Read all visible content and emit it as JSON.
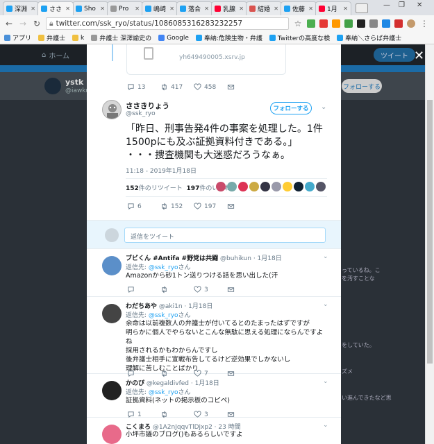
{
  "browser": {
    "tabs": [
      {
        "label": "深淵",
        "icon_color": "#1da1f2",
        "icon": "twitter-icon"
      },
      {
        "label": "ささ",
        "icon_color": "#1da1f2",
        "icon": "twitter-icon",
        "active": true
      },
      {
        "label": "Sho",
        "icon_color": "#1da1f2",
        "icon": "twitter-icon"
      },
      {
        "label": "Pro",
        "icon_color": "#999999",
        "icon": "page-icon"
      },
      {
        "label": "嶋崎",
        "icon_color": "#1da1f2",
        "icon": "twitter-icon"
      },
      {
        "label": "落合",
        "icon_color": "#1da1f2",
        "icon": "twitter-icon"
      },
      {
        "label": "乳腺",
        "icon_color": "#ff0033",
        "icon": "yahoo-icon"
      },
      {
        "label": "結婚",
        "icon_color": "#d9534f",
        "icon": "news-icon"
      },
      {
        "label": "佐藤",
        "icon_color": "#1da1f2",
        "icon": "twitter-icon"
      },
      {
        "label": "1月",
        "icon_color": "#ff0033",
        "icon": "yahoo-icon"
      }
    ],
    "url": "twitter.com/ssk_ryo/status/1086085316283232257",
    "bookmarks": [
      {
        "label": "アプリ",
        "color": "#4a90d9"
      },
      {
        "label": "弁護士",
        "color": "#f0c040"
      },
      {
        "label": "k",
        "color": "#f0c040"
      },
      {
        "label": "弁護士 深澤諭史の",
        "color": "#999999"
      },
      {
        "label": "Google",
        "color": "#4285f4"
      },
      {
        "label": "奉納:危険生物・弁護",
        "color": "#1da1f2"
      },
      {
        "label": "Twitterの高度な検",
        "color": "#1da1f2"
      },
      {
        "label": "奉納＼さらば弁護士",
        "color": "#1da1f2"
      }
    ]
  },
  "background_page": {
    "nav_home": "ホーム",
    "tweet_button": "ツイート",
    "profile_name": "ystk",
    "profile_handle": "@iawkus",
    "follow_button": "フォローする",
    "right_fragments": [
      "っているね。こ",
      "を汚すことな",
      "をしていた。",
      "ズメ",
      "い進んできたなど思"
    ]
  },
  "prev_tweet": {
    "card_url": "yh649490005.xsrv.jp",
    "replies": "13",
    "retweets": "417",
    "likes": "458"
  },
  "main_tweet": {
    "name": "ささきりょう",
    "handle": "@ssk_ryo",
    "follow_label": "フォローする",
    "text": "「昨日、刑事告発4件の事案を処理した。1件1500pにも及ぶ証拠資料付きである。」\n・・・捜査機関も大迷惑だろうなぁ。",
    "timestamp": "11:18 - 2019年1月18日",
    "retweet_count": "152",
    "retweet_label": "件のリツイート",
    "like_count": "197",
    "like_label": "件のいいね",
    "replies": "6",
    "retweets": "152",
    "likes": "197"
  },
  "reply_box": {
    "placeholder": "返信をツイート"
  },
  "replies": [
    {
      "name": "ブビくん #Antifa #野党は共闘",
      "handle": "@buhikun",
      "time": "1月18日",
      "to_prefix": "返信先:",
      "to_handle": "@ssk_ryo",
      "to_suffix": "さん",
      "text": "Amazonから砂1トン送りつける話を思い出した(汗",
      "replies": "",
      "retweets": "",
      "likes": "3",
      "avatar_color": "#5b8fc9"
    },
    {
      "name": "わだちあや",
      "handle": "@aki1n",
      "time": "1月18日",
      "to_prefix": "返信先:",
      "to_handle": "@ssk_ryo",
      "to_suffix": "さん",
      "text": "余命は以前複数人の弁護士が付いてるとのたまったはずですが\n明らかに個人でやらないとこんな無駄に思える処理にならんですよね\n採用されるかもわからんですし\n後弁護士相手に宣戦布告してるけど逆効果でしかないし\n理解に苦しむことばかり",
      "replies": "",
      "retweets": "",
      "likes": "7",
      "avatar_color": "#444444"
    },
    {
      "name": "かのぴ",
      "handle": "@kegaldivfed",
      "time": "1月18日",
      "to_prefix": "返信先:",
      "to_handle": "@ssk_ryo",
      "to_suffix": "さん",
      "text": "証拠資料(ネットの掲示板のコピペ)",
      "replies": "1",
      "retweets": "",
      "likes": "3",
      "avatar_color": "#222222"
    },
    {
      "name": "こくまろ",
      "handle": "@1A2nJqqvTlDjxp2",
      "time": "23 時間",
      "to_prefix": "",
      "to_handle": "",
      "to_suffix": "",
      "text": "小坪市議のブログ()もあるらしいですよ",
      "replies": "",
      "retweets": "",
      "likes": "",
      "avatar_color": "#e86a8a"
    }
  ]
}
